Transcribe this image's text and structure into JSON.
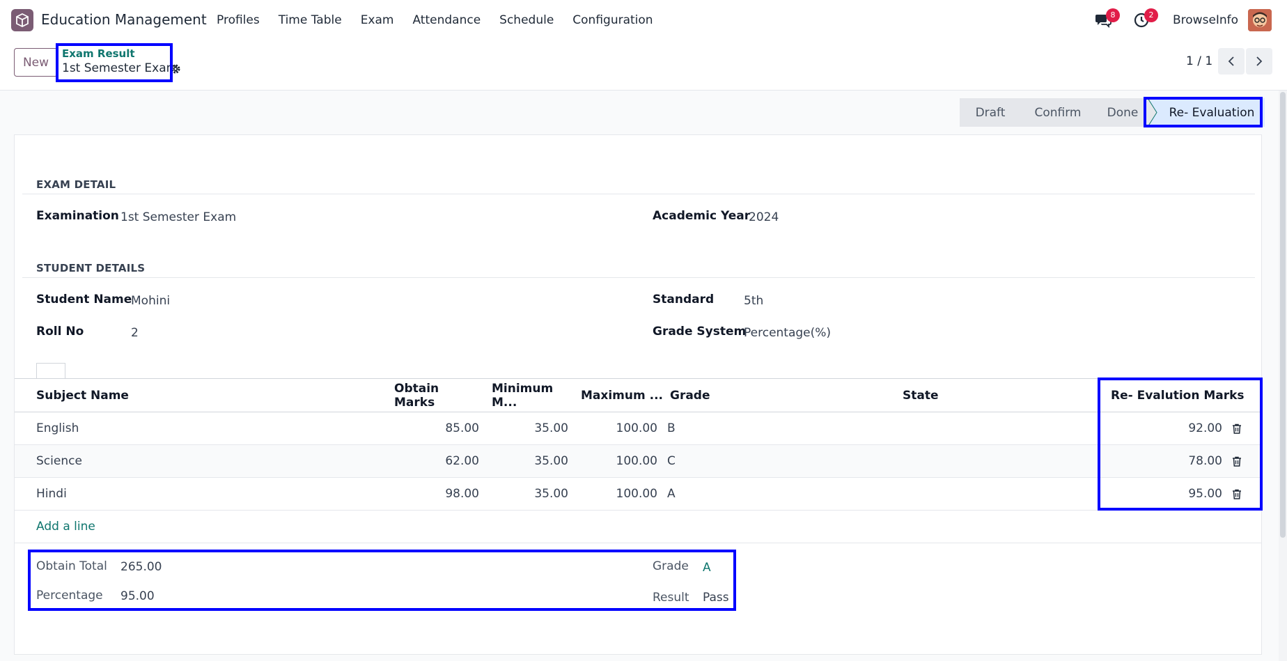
{
  "navbar": {
    "app_title": "Education Management",
    "menu": [
      "Profiles",
      "Time Table",
      "Exam",
      "Attendance",
      "Schedule",
      "Configuration"
    ],
    "messages_count": "8",
    "activities_count": "2",
    "company": "BrowseInfo"
  },
  "control": {
    "new_label": "New",
    "breadcrumb_parent": "Exam Result",
    "breadcrumb_current": "1st Semester Exam",
    "pager": "1 / 1"
  },
  "status": {
    "stages": [
      "Draft",
      "Confirm",
      "Done",
      "Re- Evaluation"
    ],
    "active": "Re- Evaluation"
  },
  "exam_detail": {
    "title": "EXAM DETAIL",
    "examination_label": "Examination",
    "examination_value": "1st Semester Exam",
    "academic_year_label": "Academic Year",
    "academic_year_value": "2024"
  },
  "student_details": {
    "title": "STUDENT DETAILS",
    "student_name_label": "Student Name",
    "student_name_value": "Mohini",
    "standard_label": "Standard",
    "standard_value": "5th",
    "roll_no_label": "Roll No",
    "roll_no_value": "2",
    "grade_system_label": "Grade System",
    "grade_system_value": "Percentage(%)"
  },
  "lines": {
    "headers": {
      "subject": "Subject Name",
      "obtain": "Obtain Marks",
      "minimum": "Minimum M...",
      "maximum": "Maximum ...",
      "grade": "Grade",
      "state": "State",
      "reeval": "Re- Evalution Marks"
    },
    "rows": [
      {
        "subject": "English",
        "obtain": "85.00",
        "minimum": "35.00",
        "maximum": "100.00",
        "grade": "B",
        "state": "",
        "reeval": "92.00"
      },
      {
        "subject": "Science",
        "obtain": "62.00",
        "minimum": "35.00",
        "maximum": "100.00",
        "grade": "C",
        "state": "",
        "reeval": "78.00"
      },
      {
        "subject": "Hindi",
        "obtain": "98.00",
        "minimum": "35.00",
        "maximum": "100.00",
        "grade": "A",
        "state": "",
        "reeval": "95.00"
      }
    ],
    "add_line": "Add a line"
  },
  "totals": {
    "obtain_total_label": "Obtain Total",
    "obtain_total_value": "265.00",
    "percentage_label": "Percentage",
    "percentage_value": "95.00",
    "grade_label": "Grade",
    "grade_value": "A",
    "result_label": "Result",
    "result_value": "Pass"
  },
  "colors": {
    "brand": "#7b5c74",
    "link": "#0f766e",
    "highlight": "#0000ff",
    "badge": "#e11d48"
  }
}
